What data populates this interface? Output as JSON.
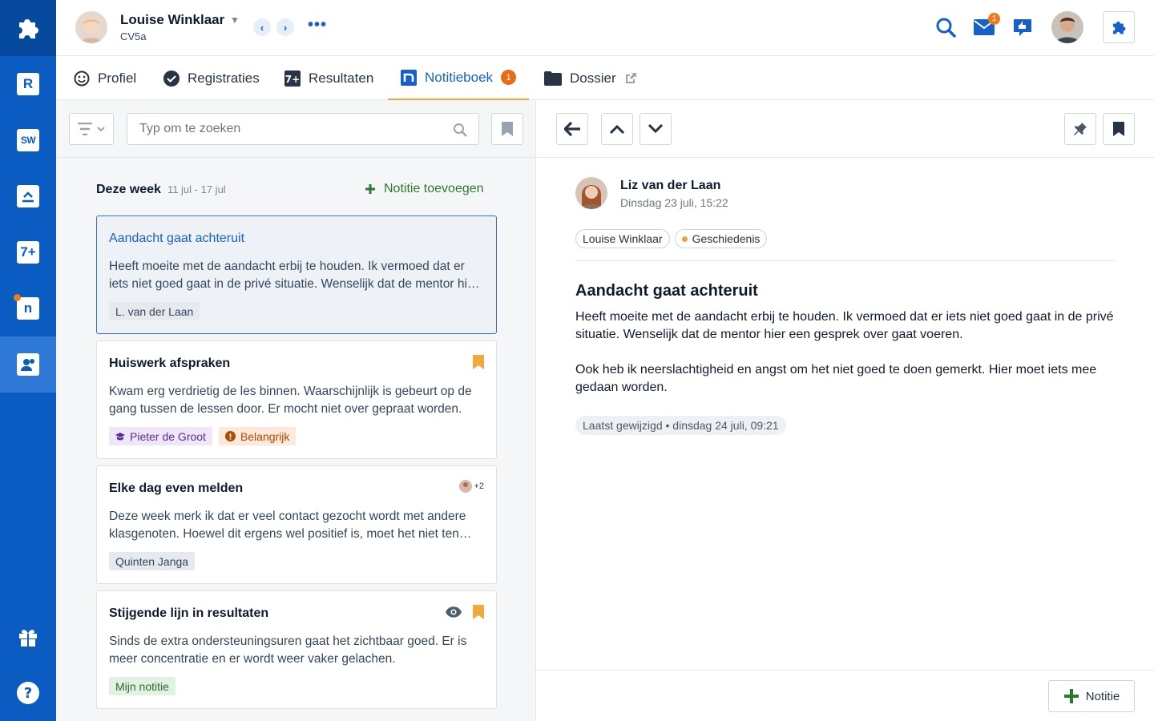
{
  "header": {
    "student_name": "Louise Winklaar",
    "student_class": "CV5a",
    "mail_badge": "1"
  },
  "rail": {
    "items": [
      {
        "icon": "puzzle-icon"
      },
      {
        "icon": "roster-icon",
        "label": "R"
      },
      {
        "icon": "studiewijzer-icon",
        "label": "SW"
      },
      {
        "icon": "tasks-icon"
      },
      {
        "icon": "results-icon",
        "label": "7+"
      },
      {
        "icon": "notebook-icon",
        "label": "n"
      },
      {
        "icon": "students-icon"
      },
      {
        "icon": "gift-icon"
      },
      {
        "icon": "help-icon",
        "label": "?"
      }
    ]
  },
  "tabs": [
    {
      "label": "Profiel"
    },
    {
      "label": "Registraties"
    },
    {
      "label": "Resultaten"
    },
    {
      "label": "Notitieboek",
      "badge": "1"
    },
    {
      "label": "Dossier"
    }
  ],
  "list": {
    "search_placeholder": "Typ om te zoeken",
    "week_label": "Deze week",
    "week_range": "11 jul - 17 jul",
    "add_label": "Notitie toevoegen",
    "notes": [
      {
        "title": "Aandacht gaat achteruit",
        "body": "Heeft moeite met de aandacht erbij te houden. Ik vermoed dat er iets niet goed gaat in de privé situatie. Wenselijk dat de mentor hier een gesprek over gaat voeren.",
        "chips": [
          {
            "label": "L. van der Laan"
          }
        ]
      },
      {
        "title": "Huiswerk afspraken",
        "body": "Kwam erg verdrietig de les binnen. Waarschijnlijk is gebeurt op de gang tussen de lessen door. Er mocht niet over gepraat worden.",
        "chips": [
          {
            "label": "Pieter de Groot"
          },
          {
            "label": "Belangrijk"
          }
        ]
      },
      {
        "title": "Elke dag even melden",
        "body": "Deze week merk ik dat er veel contact gezocht wordt met andere klasgenoten. Hoewel dit ergens wel positief is, moet het niet ten koste gaan van de les.",
        "extra_count": "+2",
        "chips": [
          {
            "label": "Quinten Janga"
          }
        ]
      },
      {
        "title": "Stijgende lijn in resultaten",
        "body": "Sinds de extra ondersteuningsuren gaat het zichtbaar goed. Er is meer concentratie en er wordt weer vaker gelachen.",
        "chips": [
          {
            "label": "Mijn notitie"
          }
        ]
      }
    ]
  },
  "detail": {
    "author": "Liz van der Laan",
    "date": "Dinsdag 23 juli, 15:22",
    "tags": [
      {
        "label": "Louise Winklaar"
      },
      {
        "label": "Geschiedenis"
      }
    ],
    "title": "Aandacht gaat achteruit",
    "paragraphs": [
      "Heeft moeite met de aandacht erbij te houden. Ik vermoed dat er iets niet goed gaat in de privé situatie. Wenselijk dat de mentor hier een gesprek over gaat voeren.",
      "Ook heb ik neerslachtigheid en angst om het niet goed te doen gemerkt. Hier moet iets mee gedaan worden."
    ],
    "modified": "Laatst gewijzigd • dinsdag 24 juli, 09:21",
    "note_button": "Notitie"
  },
  "colors": {
    "rail": "#0a5cc2",
    "accent": "#1760c9",
    "badge": "#e76c14",
    "add": "#2b7a2b",
    "bookmark": "#f0a93c"
  }
}
